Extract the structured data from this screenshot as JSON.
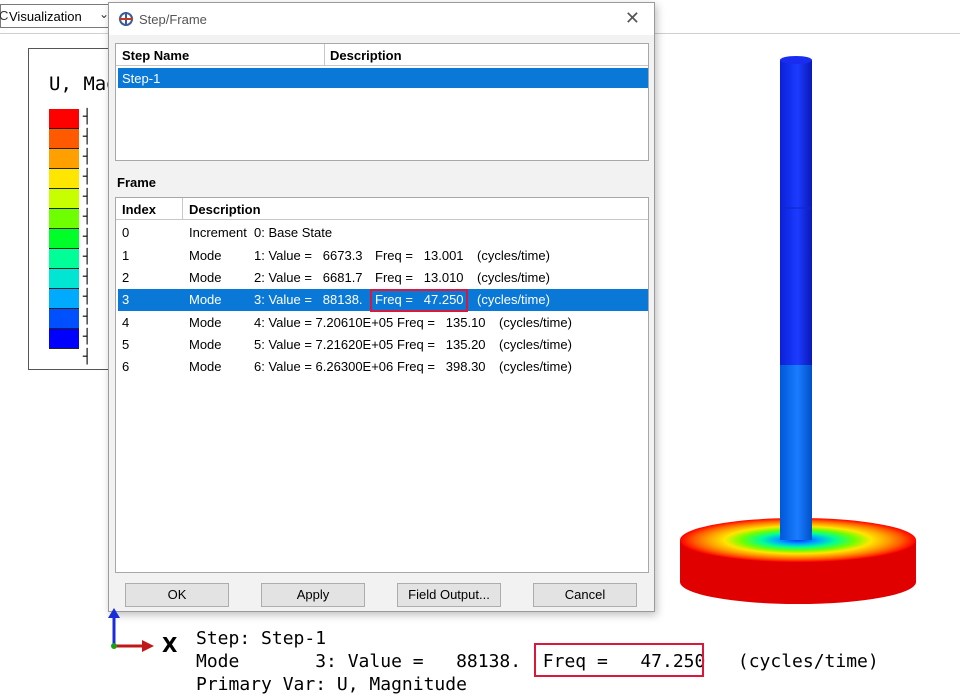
{
  "toolbar": {
    "module_label": "Visualization",
    "module_edge_glyph": "C"
  },
  "legend": {
    "title": "U, Mag",
    "colors": [
      "#ff0000",
      "#ff5a00",
      "#ffa000",
      "#ffe600",
      "#c8ff00",
      "#6eff00",
      "#00ff28",
      "#00ff96",
      "#00e6d2",
      "#00aaff",
      "#0050ff",
      "#0000ff"
    ],
    "tick_glyph": "┤"
  },
  "dialog": {
    "title": "Step/Frame",
    "close_glyph": "✕",
    "step_table": {
      "col_step_name": "Step Name",
      "col_description": "Description",
      "rows": [
        {
          "name": "Step-1",
          "description": ""
        }
      ]
    },
    "frame_label": "Frame",
    "frame_table": {
      "col_index": "Index",
      "col_description": "Description",
      "rows": [
        {
          "index": "0",
          "type": "Increment",
          "value": "0: Base State",
          "freq": "",
          "unit": ""
        },
        {
          "index": "1",
          "type": "Mode",
          "value": "1: Value =   6673.3",
          "freq": "Freq =   13.001",
          "unit": "(cycles/time)"
        },
        {
          "index": "2",
          "type": "Mode",
          "value": "2: Value =   6681.7",
          "freq": "Freq =   13.010",
          "unit": "(cycles/time)"
        },
        {
          "index": "3",
          "type": "Mode",
          "value": "3: Value =   88138.",
          "freq": "Freq =   47.250",
          "unit": "(cycles/time)"
        },
        {
          "index": "4",
          "type": "Mode",
          "value": "4: Value = 7.20610E+05",
          "freq": "Freq =   135.10",
          "unit": "(cycles/time)"
        },
        {
          "index": "5",
          "type": "Mode",
          "value": "5: Value = 7.21620E+05",
          "freq": "Freq =   135.20",
          "unit": "(cycles/time)"
        },
        {
          "index": "6",
          "type": "Mode",
          "value": "6: Value = 6.26300E+06",
          "freq": "Freq =   398.30",
          "unit": "(cycles/time)"
        }
      ]
    },
    "buttons": {
      "ok": "OK",
      "apply": "Apply",
      "field_output": "Field Output...",
      "cancel": "Cancel"
    }
  },
  "viewport_info": {
    "axis_x_label": "X",
    "line1": "Step: Step-1",
    "line2": "Mode       3: Value =   88138.  ",
    "line2_freq": "Freq =   47.250",
    "line2_unit": "   (cycles/time)",
    "line3": "Primary Var: U, Magnitude"
  },
  "colors": {
    "selection": "#0a78d7",
    "highlight_box": "#d9183b"
  }
}
